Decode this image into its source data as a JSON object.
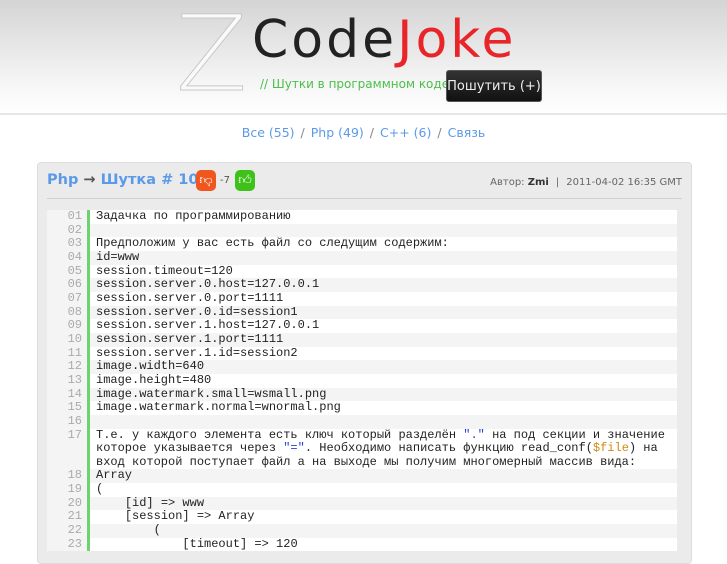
{
  "header": {
    "logo_letter": "Z",
    "brand_part1": "Code",
    "brand_part2": "Joke",
    "tagline": "// Шутки в программном коде",
    "add_button": "Пошутить (+)"
  },
  "nav": {
    "items": [
      {
        "label": "Все (55)"
      },
      {
        "label": "Php (49)"
      },
      {
        "label": "C++ (6)"
      },
      {
        "label": "Связь"
      }
    ],
    "separator": "/"
  },
  "post": {
    "category": "Php",
    "arrow": "→",
    "title": "Шутка # 104",
    "score": "-7",
    "author_label": "Автор:",
    "author": "Zmi",
    "separator": "|",
    "date": "2011-04-02 16:35 GMT",
    "vote_down_icon": "thumbs-down-icon",
    "vote_up_icon": "thumbs-up-icon"
  },
  "colors": {
    "accent": "#5b9ae8",
    "brand_red": "#e8262a",
    "tagline_green": "#4cbf4c",
    "gutter_green": "#6ed26e"
  },
  "code_lines": [
    {
      "n": "01",
      "parts": [
        {
          "t": "Задачка по программированию"
        }
      ]
    },
    {
      "n": "02",
      "parts": [
        {
          "t": ""
        }
      ]
    },
    {
      "n": "03",
      "parts": [
        {
          "t": "Предположим у вас есть файл со следущим содержим:"
        }
      ]
    },
    {
      "n": "04",
      "parts": [
        {
          "t": "id=www"
        }
      ]
    },
    {
      "n": "05",
      "parts": [
        {
          "t": "session.timeout=120"
        }
      ]
    },
    {
      "n": "06",
      "parts": [
        {
          "t": "session.server.0.host=127.0.0.1"
        }
      ]
    },
    {
      "n": "07",
      "parts": [
        {
          "t": "session.server.0.port=1111"
        }
      ]
    },
    {
      "n": "08",
      "parts": [
        {
          "t": "session.server.0.id=session1"
        }
      ]
    },
    {
      "n": "09",
      "parts": [
        {
          "t": "session.server.1.host=127.0.0.1"
        }
      ]
    },
    {
      "n": "10",
      "parts": [
        {
          "t": "session.server.1.port=1111"
        }
      ]
    },
    {
      "n": "11",
      "parts": [
        {
          "t": "session.server.1.id=session2"
        }
      ]
    },
    {
      "n": "12",
      "parts": [
        {
          "t": "image.width=640"
        }
      ]
    },
    {
      "n": "13",
      "parts": [
        {
          "t": "image.height=480"
        }
      ]
    },
    {
      "n": "14",
      "parts": [
        {
          "t": "image.watermark.small=wsmall.png"
        }
      ]
    },
    {
      "n": "15",
      "parts": [
        {
          "t": "image.watermark.normal=wnormal.png"
        }
      ]
    },
    {
      "n": "16",
      "parts": [
        {
          "t": ""
        }
      ]
    },
    {
      "n": "17",
      "parts": [
        {
          "t": "Т.е. у каждого элемента есть ключ который разделён "
        },
        {
          "t": "\".\"",
          "c": "str"
        },
        {
          "t": " на под секции и значение которое указывается через "
        },
        {
          "t": "\"=\"",
          "c": "str"
        },
        {
          "t": ". Необходимо написать функцию read_conf("
        },
        {
          "t": "$file",
          "c": "var"
        },
        {
          "t": ") на вход которой поступает файл а на выходе мы получим многомерный массив вида:"
        }
      ]
    },
    {
      "n": "18",
      "parts": [
        {
          "t": "Array"
        }
      ]
    },
    {
      "n": "19",
      "parts": [
        {
          "t": "("
        }
      ]
    },
    {
      "n": "20",
      "parts": [
        {
          "t": "    [id] => www"
        }
      ]
    },
    {
      "n": "21",
      "parts": [
        {
          "t": "    [session] => Array"
        }
      ]
    },
    {
      "n": "22",
      "parts": [
        {
          "t": "        ("
        }
      ]
    },
    {
      "n": "23",
      "parts": [
        {
          "t": "            [timeout] => 120"
        }
      ]
    }
  ]
}
